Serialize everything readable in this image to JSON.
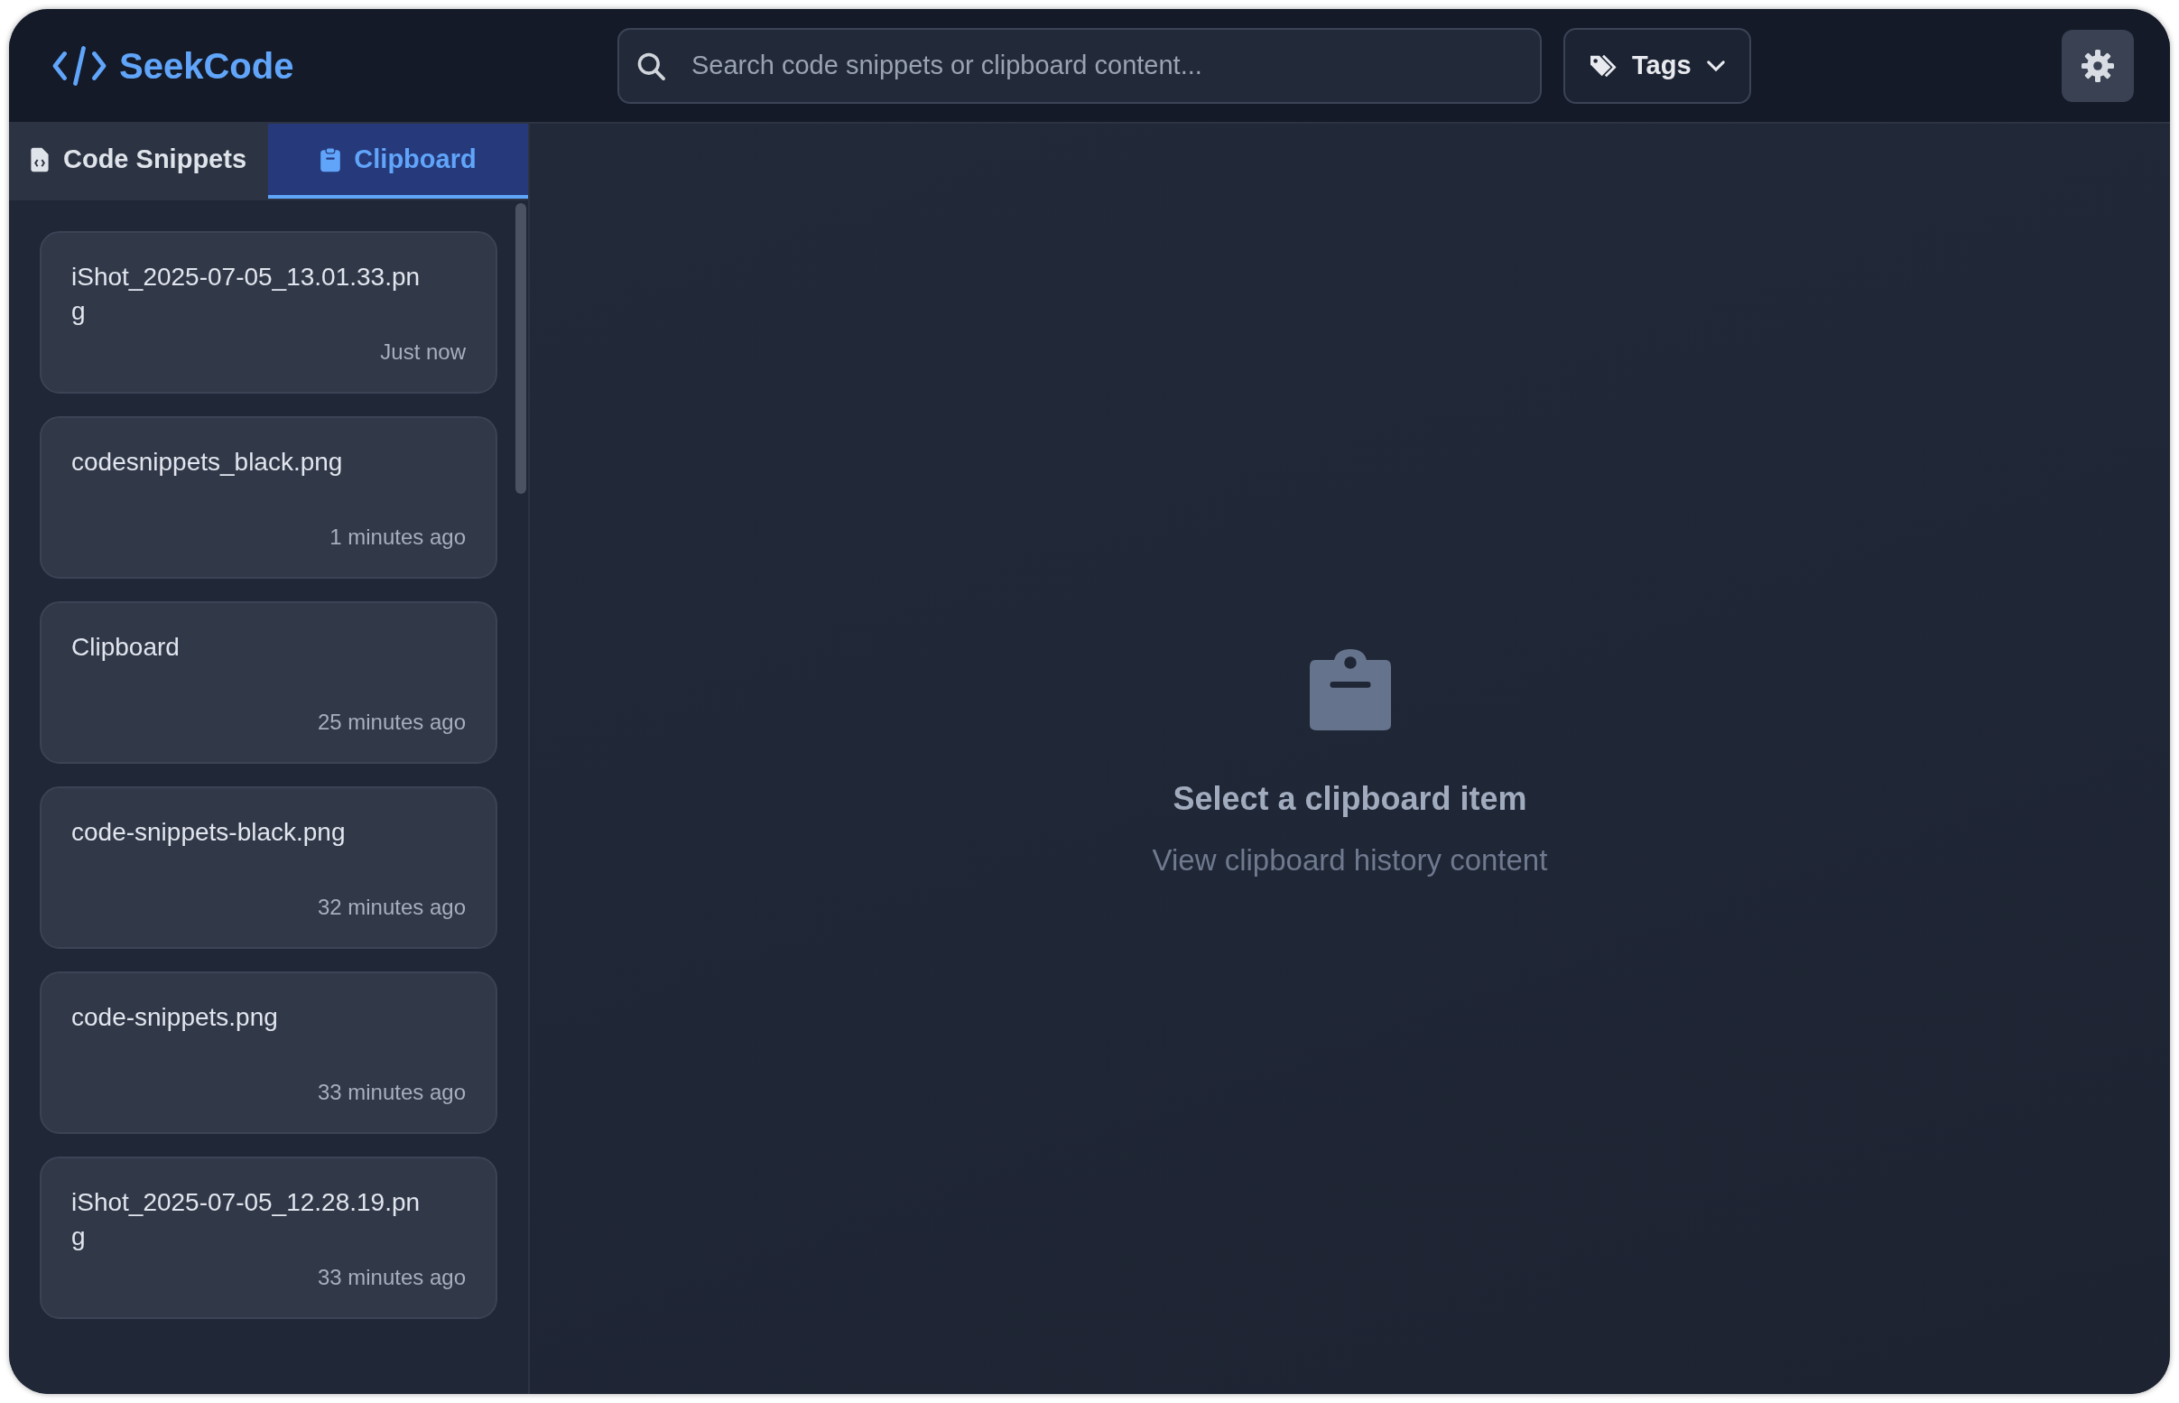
{
  "app": {
    "name": "SeekCode"
  },
  "search": {
    "placeholder": "Search code snippets or clipboard content..."
  },
  "tags_button": {
    "label": "Tags"
  },
  "tabs": [
    {
      "label": "Code Snippets",
      "kind": "snippets",
      "selected": false
    },
    {
      "label": "Clipboard",
      "kind": "clipboard",
      "selected": true
    }
  ],
  "clipboard_items": [
    {
      "title": "iShot_2025-07-05_13.01.33.png",
      "time": "Just now"
    },
    {
      "title": "codesnippets_black.png",
      "time": "1 minutes ago"
    },
    {
      "title": "Clipboard",
      "time": "25 minutes ago"
    },
    {
      "title": "code-snippets-black.png",
      "time": "32 minutes ago"
    },
    {
      "title": "code-snippets.png",
      "time": "33 minutes ago"
    },
    {
      "title": "iShot_2025-07-05_12.28.19.png",
      "time": "33 minutes ago"
    }
  ],
  "empty_state": {
    "title": "Select a clipboard item",
    "subtitle": "View clipboard history content"
  }
}
